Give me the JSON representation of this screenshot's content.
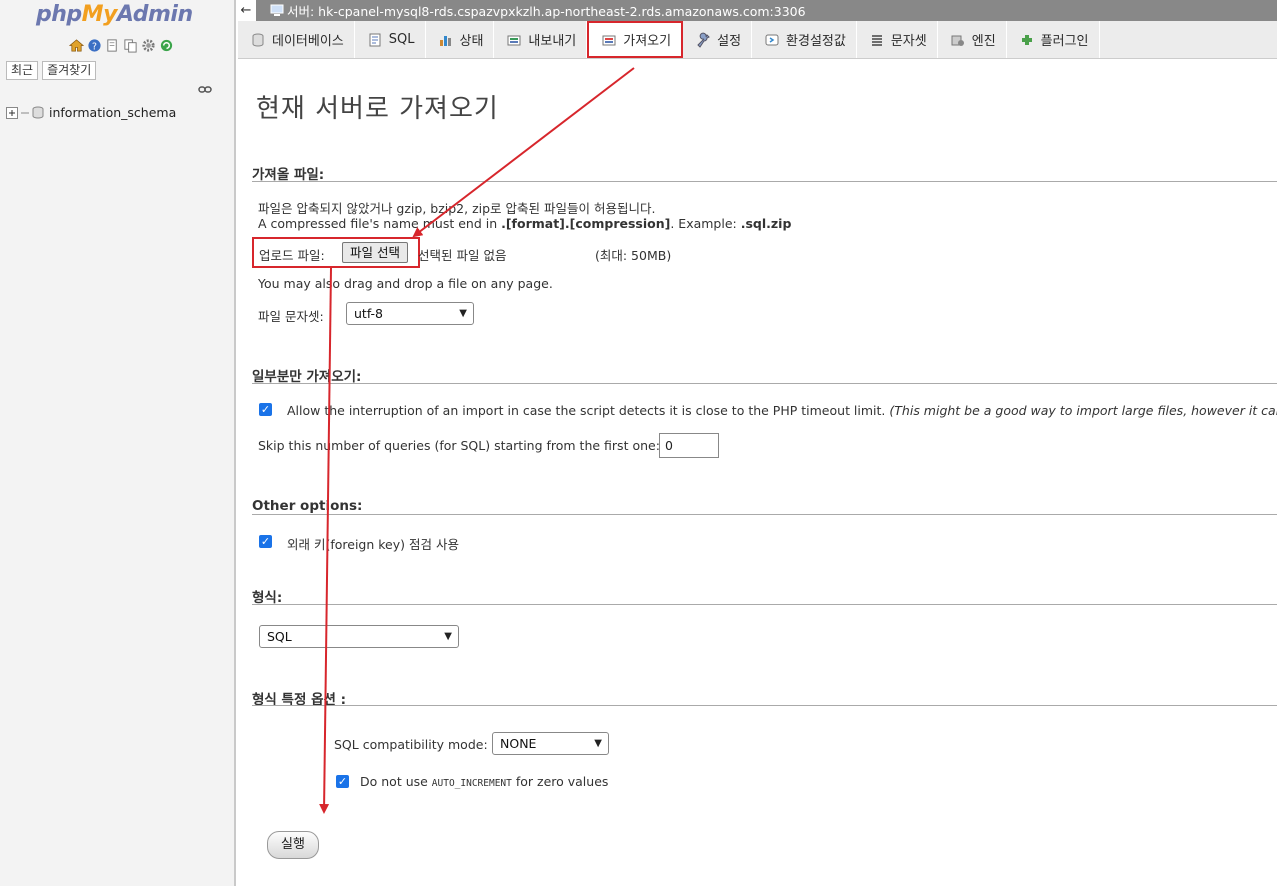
{
  "nav": {
    "logo": {
      "php": "php",
      "my": "My",
      "admin": "Admin"
    },
    "icons": [
      "home-icon",
      "help-icon",
      "docs-icon",
      "copy-icon",
      "settings-icon",
      "reload-icon"
    ],
    "tabs": {
      "recent": "최근",
      "favorites": "즐겨찾기"
    },
    "tree": [
      {
        "label": "information_schema"
      }
    ]
  },
  "topbar": {
    "back": "←",
    "server": "서버: hk-cpanel-mysql8-rds.cspazvpxkzlh.ap-northeast-2.rds.amazonaws.com:3306"
  },
  "menu": [
    {
      "label": "데이터베이스",
      "icon": "database-icon"
    },
    {
      "label": "SQL",
      "icon": "sql-icon"
    },
    {
      "label": "상태",
      "icon": "status-icon"
    },
    {
      "label": "내보내기",
      "icon": "export-icon"
    },
    {
      "label": "가져오기",
      "icon": "import-icon",
      "active": true
    },
    {
      "label": "설정",
      "icon": "wrench-icon"
    },
    {
      "label": "환경설정값",
      "icon": "variables-icon"
    },
    {
      "label": "문자셋",
      "icon": "charset-icon"
    },
    {
      "label": "엔진",
      "icon": "engine-icon"
    },
    {
      "label": "플러그인",
      "icon": "plugin-icon"
    }
  ],
  "main": {
    "title": "현재 서버로 가져오기",
    "file_section": {
      "legend": "가져올 파일:",
      "desc1": "파일은 압축되지 않았거나 gzip, bzip2, zip로 압축된 파일들이 허용됩니다.",
      "desc2_a": "A compressed file's name must end in ",
      "desc2_b": ".[format].[compression]",
      "desc2_c": ". Example: ",
      "desc2_d": ".sql.zip",
      "upload_label": "업로드 파일:",
      "choose_button": "파일 선택",
      "no_file": "선택된 파일 없음",
      "max_size": "(최대: 50MB)",
      "drag_hint": "You may also drag and drop a file on any page.",
      "charset_label": "파일 문자셋:",
      "charset_value": "utf-8"
    },
    "partial_section": {
      "legend": "일부분만 가져오기:",
      "allow_interrupt": "Allow the interruption of an import in case the script detects it is close to the PHP timeout limit.",
      "allow_interrupt_note": "(This might be a good way to import large files, however it can bre",
      "skip_label": "Skip this number of queries (for SQL) starting from the first one:",
      "skip_value": "0"
    },
    "other_section": {
      "legend": "Other options:",
      "foreign_key": "외래 키(foreign key) 점검 사용"
    },
    "format_section": {
      "legend": "형식:",
      "value": "SQL"
    },
    "format_options": {
      "legend": "형식 특정 옵션 :",
      "compat_label": "SQL compatibility mode:",
      "compat_value": "NONE",
      "auto_inc_a": "Do not use ",
      "auto_inc_b": "AUTO_INCREMENT",
      "auto_inc_c": " for zero values"
    },
    "go_button": "실행"
  },
  "colors": {
    "highlight": "#d7262c",
    "checkbox": "#1a73e8"
  }
}
